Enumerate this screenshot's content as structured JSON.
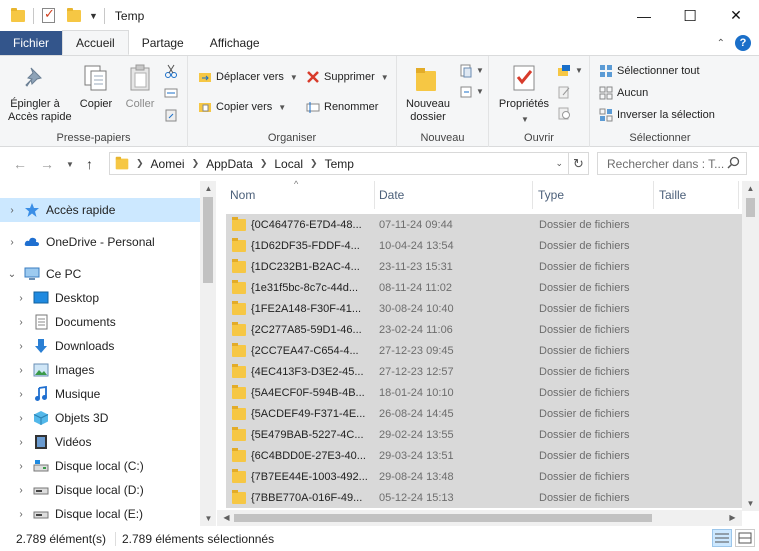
{
  "window": {
    "title": "Temp",
    "minimize": "—",
    "maximize": "☐",
    "close": "✕"
  },
  "tabs": [
    {
      "label": "Fichier"
    },
    {
      "label": "Accueil"
    },
    {
      "label": "Partage"
    },
    {
      "label": "Affichage"
    }
  ],
  "ribbon": {
    "presse_papiers": {
      "label": "Presse-papiers",
      "epingler": "Épingler à\nAccès rapide",
      "copier": "Copier",
      "coller": "Coller"
    },
    "organiser": {
      "label": "Organiser",
      "deplacer": "Déplacer vers",
      "copier_vers": "Copier vers",
      "supprimer": "Supprimer",
      "renommer": "Renommer"
    },
    "nouveau": {
      "label": "Nouveau",
      "dossier": "Nouveau\ndossier"
    },
    "ouvrir": {
      "label": "Ouvrir",
      "proprietes": "Propriétés"
    },
    "selectionner": {
      "label": "Sélectionner",
      "tout": "Sélectionner tout",
      "aucun": "Aucun",
      "inverser": "Inverser la sélection"
    }
  },
  "address": {
    "crumbs": [
      "Aomei",
      "AppData",
      "Local",
      "Temp"
    ],
    "search_placeholder": "Rechercher dans : T..."
  },
  "nav": {
    "items": [
      {
        "label": "Accès rapide",
        "icon": "star-icon"
      },
      {
        "label": "OneDrive - Personal",
        "icon": "cloud-icon"
      },
      {
        "label": "Ce PC",
        "icon": "computer-icon"
      },
      {
        "label": "Desktop",
        "icon": "desktop-icon"
      },
      {
        "label": "Documents",
        "icon": "documents-icon"
      },
      {
        "label": "Downloads",
        "icon": "download-icon"
      },
      {
        "label": "Images",
        "icon": "images-icon"
      },
      {
        "label": "Musique",
        "icon": "music-icon"
      },
      {
        "label": "Objets 3D",
        "icon": "cube-icon"
      },
      {
        "label": "Vidéos",
        "icon": "video-icon"
      },
      {
        "label": "Disque local (C:)",
        "icon": "drive-c-icon"
      },
      {
        "label": "Disque local (D:)",
        "icon": "drive-icon"
      },
      {
        "label": "Disque local (E:)",
        "icon": "drive-icon"
      }
    ]
  },
  "columns": {
    "name": "Nom",
    "date": "Date",
    "type": "Type",
    "size": "Taille"
  },
  "files": [
    {
      "name": "{0C464776-E7D4-48...",
      "date": "07-11-24 09:44",
      "type": "Dossier de fichiers"
    },
    {
      "name": "{1D62DF35-FDDF-4...",
      "date": "10-04-24 13:54",
      "type": "Dossier de fichiers"
    },
    {
      "name": "{1DC232B1-B2AC-4...",
      "date": "23-11-23 15:31",
      "type": "Dossier de fichiers"
    },
    {
      "name": "{1e31f5bc-8c7c-44d...",
      "date": "08-11-24 11:02",
      "type": "Dossier de fichiers"
    },
    {
      "name": "{1FE2A148-F30F-41...",
      "date": "30-08-24 10:40",
      "type": "Dossier de fichiers"
    },
    {
      "name": "{2C277A85-59D1-46...",
      "date": "23-02-24 11:06",
      "type": "Dossier de fichiers"
    },
    {
      "name": "{2CC7EA47-C654-4...",
      "date": "27-12-23 09:45",
      "type": "Dossier de fichiers"
    },
    {
      "name": "{4EC413F3-D3E2-45...",
      "date": "27-12-23 12:57",
      "type": "Dossier de fichiers"
    },
    {
      "name": "{5A4ECF0F-594B-4B...",
      "date": "18-01-24 10:10",
      "type": "Dossier de fichiers"
    },
    {
      "name": "{5ACDEF49-F371-4E...",
      "date": "26-08-24 14:45",
      "type": "Dossier de fichiers"
    },
    {
      "name": "{5E479BAB-5227-4C...",
      "date": "29-02-24 13:55",
      "type": "Dossier de fichiers"
    },
    {
      "name": "{6C4BDD0E-27E3-40...",
      "date": "29-03-24 13:51",
      "type": "Dossier de fichiers"
    },
    {
      "name": "{7B7EE44E-1003-492...",
      "date": "29-08-24 13:48",
      "type": "Dossier de fichiers"
    },
    {
      "name": "{7BBE770A-016F-49...",
      "date": "05-12-24 15:13",
      "type": "Dossier de fichiers"
    }
  ],
  "status": {
    "count": "2.789 élément(s)",
    "selected": "2.789 éléments sélectionnés"
  },
  "colors": {
    "fichier_tab": "#33558b",
    "selection": "#d9d9d9",
    "nav_selected": "#cce8ff",
    "folder": "#f6c744"
  }
}
